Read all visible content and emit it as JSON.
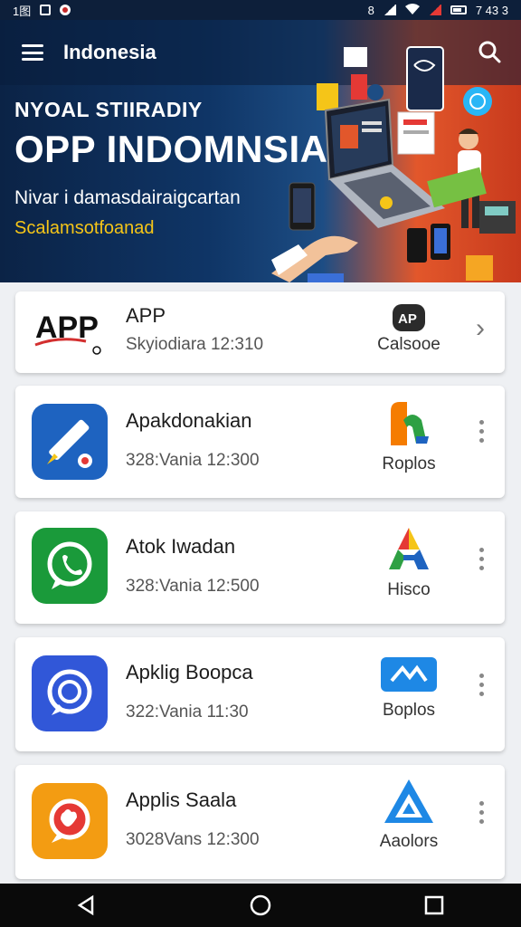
{
  "status_bar": {
    "left_text": "1图",
    "time": "7 43 3",
    "right_text": "8"
  },
  "appbar": {
    "title": "Indonesia"
  },
  "hero": {
    "subtitle": "NYOAL STIIRADIY",
    "title": "OPP INDOMNSIA",
    "description": "Nivar i damasdairaigcartan",
    "tagline": "Scalamsotfoanad"
  },
  "apps": [
    {
      "name": "APP",
      "meta": "Skyiodiara 12:310",
      "icon": "app-logo-icon",
      "badge_icon": "ap-badge-icon",
      "badge_label": "Calsooe",
      "action": "chevron-right-icon"
    },
    {
      "name": "Apakdonakian",
      "meta": "328:Vania 12:300",
      "icon": "pencil-app-icon",
      "badge_icon": "orange-green-logo-icon",
      "badge_label": "Roplos",
      "action": "more-vert-icon"
    },
    {
      "name": "Atok Iwadan",
      "meta": "328:Vania 12:500",
      "icon": "whatsapp-icon",
      "badge_icon": "multicolor-a-icon",
      "badge_label": "Hisco",
      "action": "more-vert-icon"
    },
    {
      "name": "Apklig Boopca",
      "meta": "322:Vania 11:30",
      "icon": "chat-bubble-icon",
      "badge_icon": "blue-card-icon",
      "badge_label": "Boplos",
      "action": "more-vert-icon"
    },
    {
      "name": "Applis Saala",
      "meta": "3028Vans 12:300",
      "icon": "orange-chat-icon",
      "badge_icon": "blue-triangle-icon",
      "badge_label": "Aaolors",
      "action": "more-vert-icon"
    }
  ],
  "colors": {
    "hero_dark": "#0b2346",
    "hero_orange": "#e2572b",
    "accent_yellow": "#f5c518",
    "nav_bg": "#0a0a0a"
  },
  "nav": {
    "back": "back-triangle-icon",
    "home": "home-circle-icon",
    "recents": "recents-square-icon"
  }
}
